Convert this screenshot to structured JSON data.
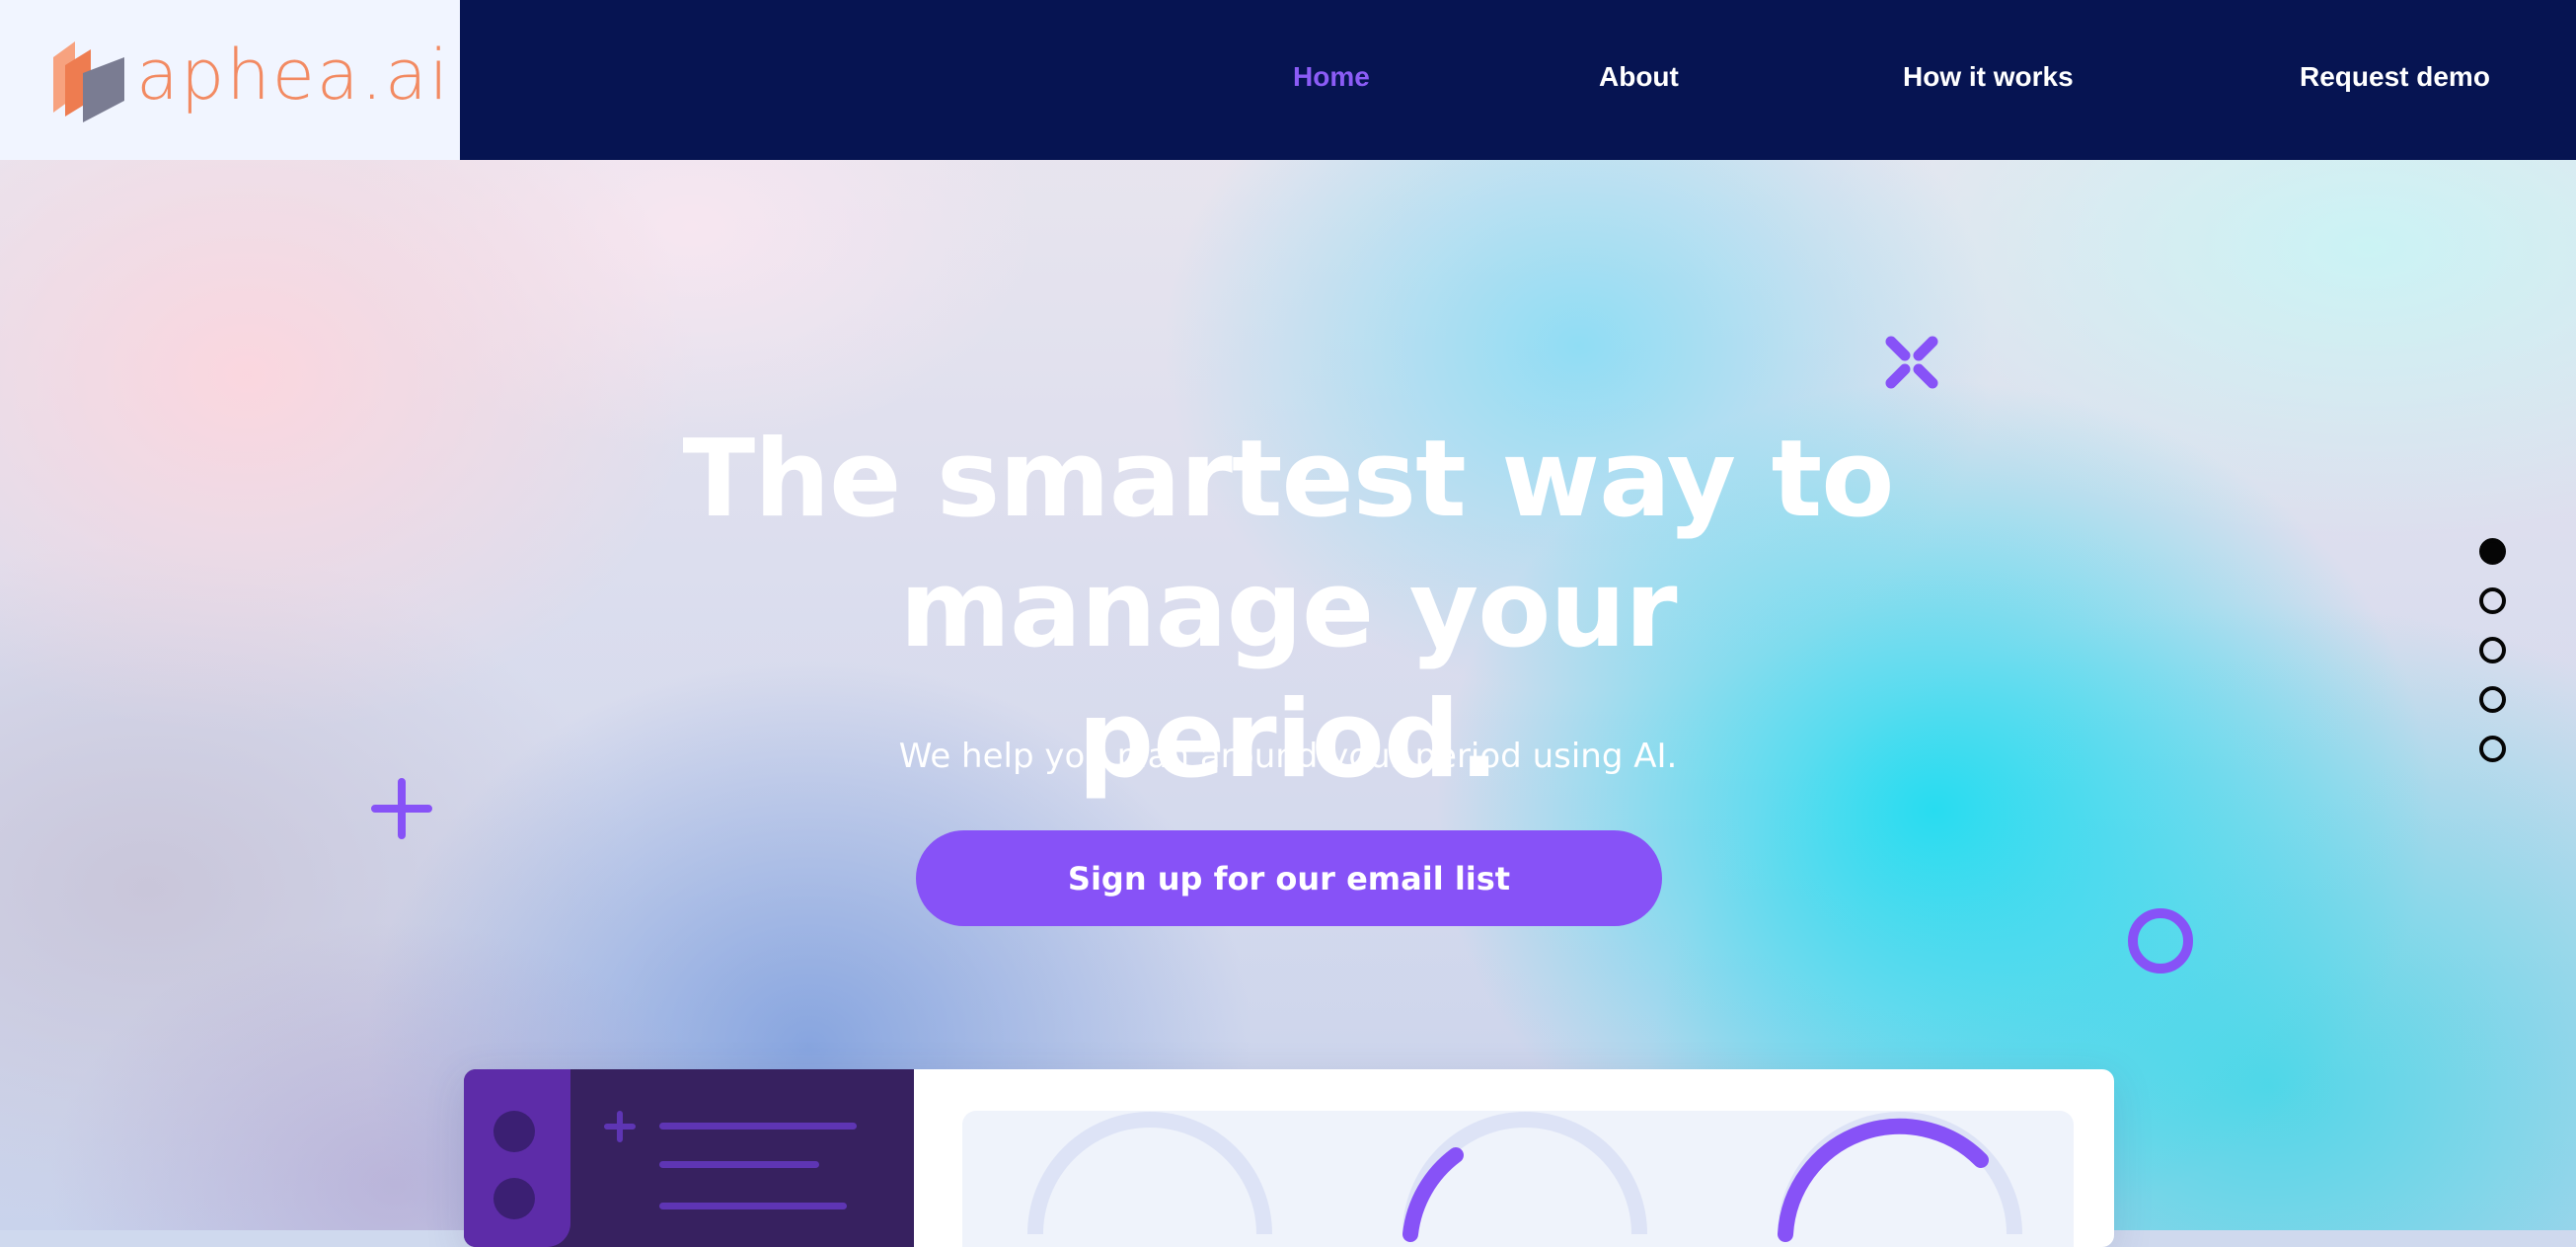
{
  "brand": {
    "name": "aphea.ai",
    "logo_colors": [
      "#f7a27f",
      "#ee7c50",
      "#7a7c92"
    ],
    "text_color": "#f28a62"
  },
  "nav": {
    "items": [
      {
        "label": "Home",
        "active": true
      },
      {
        "label": "About",
        "active": false
      },
      {
        "label": "How it works",
        "active": false
      },
      {
        "label": "Request demo",
        "active": false
      }
    ],
    "background": "#061452",
    "active_color": "#8b5cf6"
  },
  "hero": {
    "headline_line1": "The smartest way to",
    "headline_line2": "manage your period.",
    "subheadline": "We help you plan around your period using AI.",
    "cta_label": "Sign up for our email list",
    "accent": "#8752f7"
  },
  "decorations": [
    "x-shape-icon",
    "plus-icon",
    "ring-icon"
  ],
  "pagination": {
    "total": 5,
    "active_index": 0
  },
  "preview": {
    "sidebar_color": "#372160",
    "panel_color": "#eff3fb",
    "arc_color": "#8752f7",
    "arc_track_color": "#dde3f6"
  }
}
